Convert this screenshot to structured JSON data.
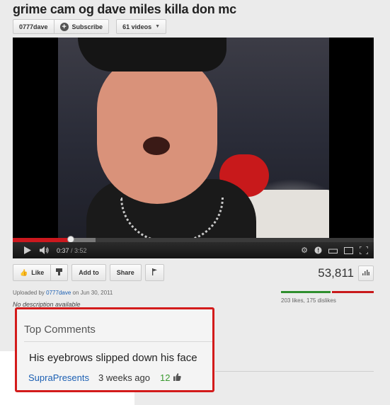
{
  "video": {
    "title": "grime cam og dave miles killa don mc",
    "channel_button": "0777dave",
    "subscribe_label": "Subscribe",
    "videos_count_label": "61 videos",
    "current_time": "0:37",
    "duration": "3:52",
    "progress_fraction": 0.16,
    "buffered_fraction": 0.23
  },
  "actions": {
    "like_label": "Like",
    "add_to_label": "Add to",
    "share_label": "Share",
    "views": "53,811",
    "likes_summary": "203 likes, 175 dislikes",
    "like_fraction": 0.537
  },
  "upload": {
    "prefix": "Uploaded by",
    "uploader": "0777dave",
    "on_text": "on Jun 30, 2011",
    "description": "No description available"
  },
  "comments": {
    "heading": "Top Comments",
    "items": [
      {
        "text": "His eyebrows slipped down his face",
        "author": "SupraPresents",
        "time_ago": "3 weeks ago",
        "score": "12"
      }
    ]
  },
  "colors": {
    "accent_red": "#cc181e",
    "like_green": "#2f8e2e",
    "link_blue": "#1b5fb3",
    "highlight_box": "#d31b1b"
  },
  "icons": [
    "plus-icon",
    "caret-down-icon",
    "play-icon",
    "volume-icon",
    "settings-gear-icon",
    "annotations-icon",
    "small-player-icon",
    "large-player-icon",
    "fullscreen-icon",
    "thumbs-up-icon",
    "thumbs-down-icon",
    "flag-icon",
    "stats-icon"
  ]
}
